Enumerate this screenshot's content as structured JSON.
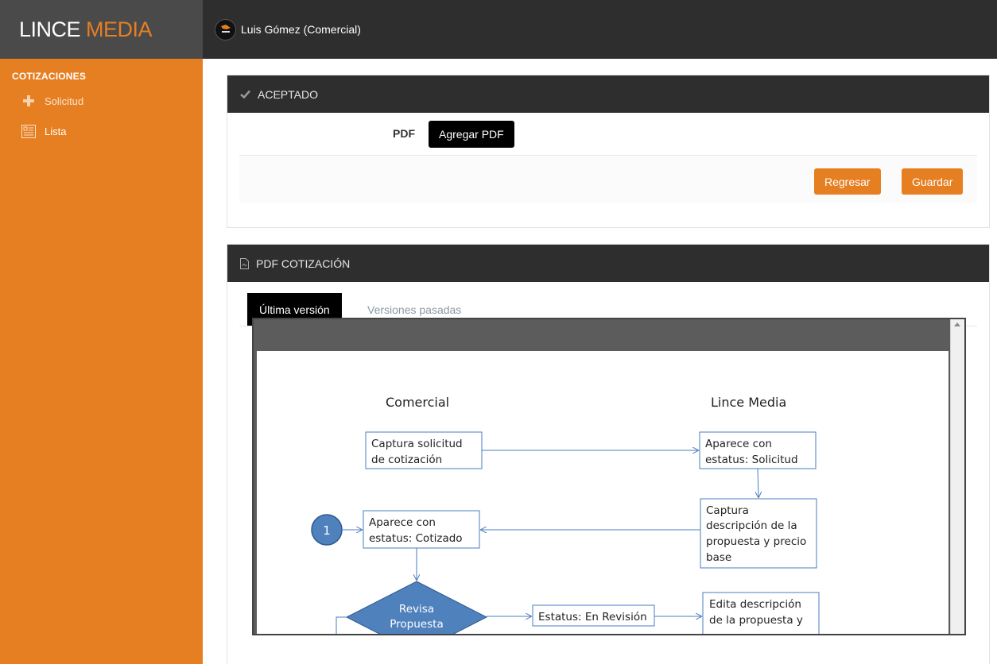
{
  "brand": {
    "name_part1": "LINCE",
    "name_part2": "MEDIA",
    "accent": "#e67f22"
  },
  "topbar": {
    "user": "Luis Gómez (Comercial)"
  },
  "sidebar": {
    "section": "COTIZACIONES",
    "items": [
      {
        "label": "Solicitud",
        "icon": "plus-icon"
      },
      {
        "label": "Lista",
        "icon": "list-icon"
      }
    ]
  },
  "status_panel": {
    "title": "ACEPTADO",
    "pdf_label": "PDF",
    "add_pdf": "Agregar PDF",
    "back": "Regresar",
    "save": "Guardar"
  },
  "pdf_panel": {
    "title": "PDF COTIZACIÓN",
    "tabs": [
      "Última versión",
      "Versiones pasadas"
    ]
  },
  "diagram": {
    "lane_left": "Comercial",
    "lane_right": "Lince Media",
    "box1": [
      "Captura solicitud",
      "de cotización"
    ],
    "box2": [
      "Aparece con",
      "estatus: Solicitud"
    ],
    "box3": [
      "Captura",
      "descripción de la",
      "propuesta y precio",
      "base"
    ],
    "box4": [
      "Aparece con",
      "estatus: Cotizado"
    ],
    "circle": "1",
    "diamond": [
      "Revisa",
      "Propuesta"
    ],
    "box5": "Estatus: En Revisión",
    "box6": [
      "Edita descripción",
      "de la propuesta y"
    ]
  }
}
